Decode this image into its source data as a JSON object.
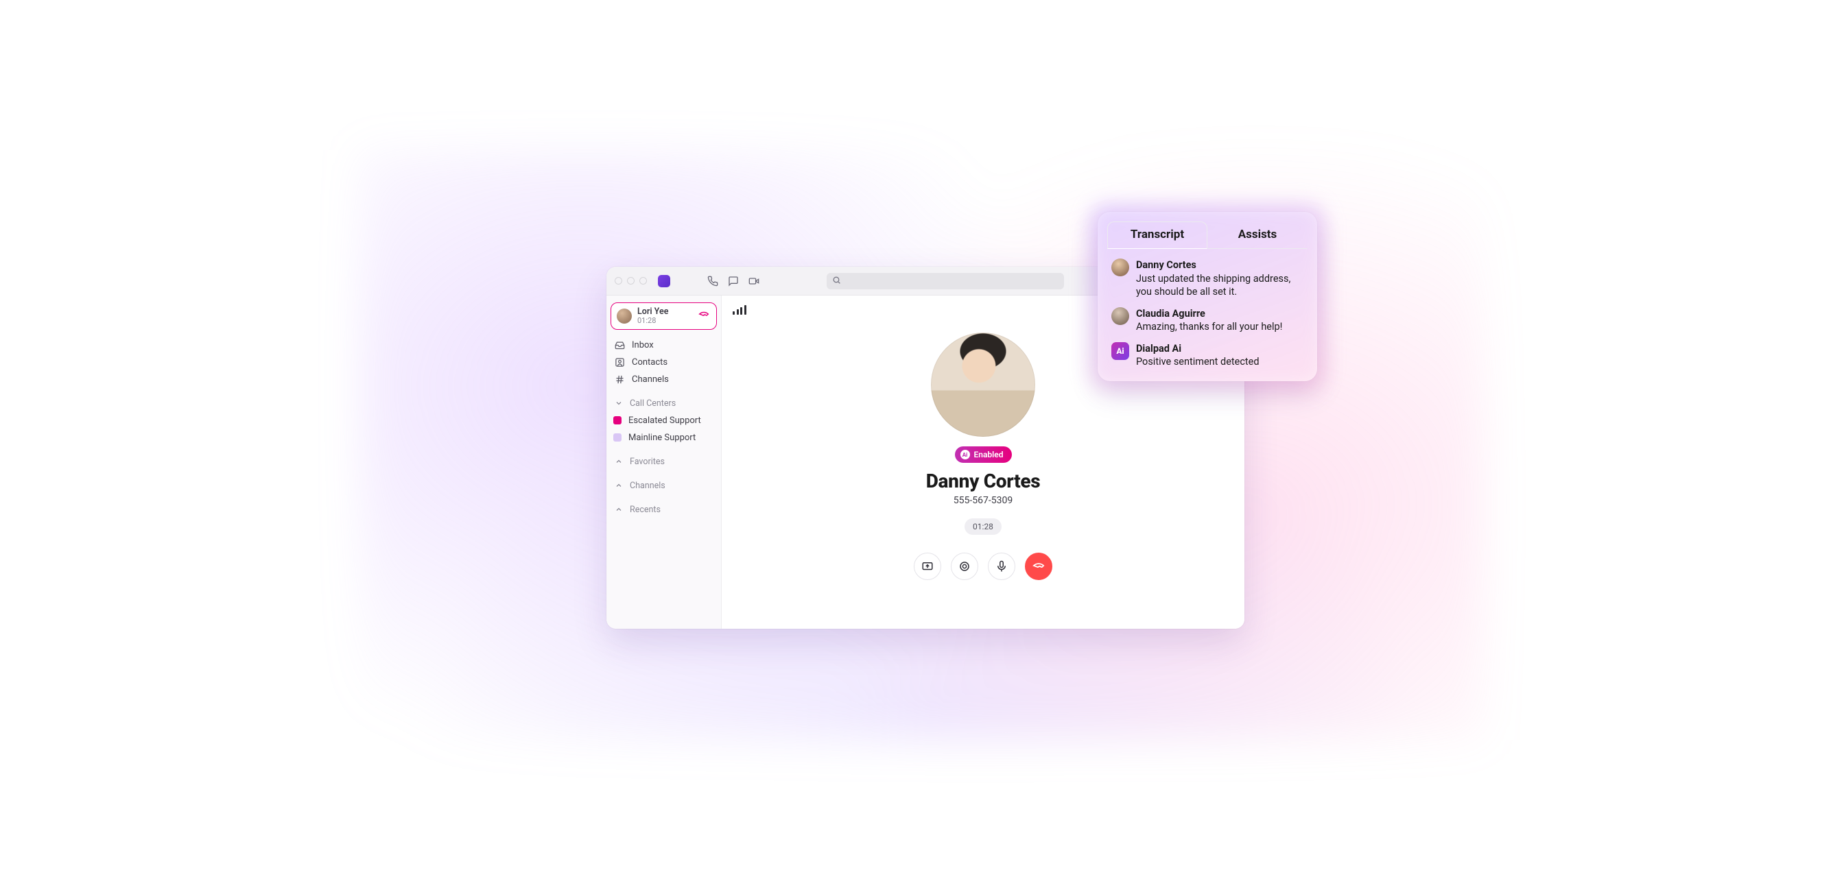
{
  "colors": {
    "brand_pink": "#E6007E",
    "brand_purple": "#7B3FE4",
    "end_red": "#FF4A4A"
  },
  "sidebar": {
    "active_call": {
      "name": "Lori Yee",
      "duration": "01:28"
    },
    "primary": [
      {
        "label": "Inbox"
      },
      {
        "label": "Contacts"
      },
      {
        "label": "Channels"
      }
    ],
    "call_centers_header": "Call Centers",
    "call_centers": [
      {
        "label": "Escalated Support",
        "color": "#E6007E"
      },
      {
        "label": "Mainline Support",
        "color": "#D9C6F5"
      }
    ],
    "collapsed": [
      {
        "label": "Favorites"
      },
      {
        "label": "Channels"
      },
      {
        "label": "Recents"
      }
    ]
  },
  "call": {
    "ai_pill": "Enabled",
    "name": "Danny Cortes",
    "phone": "555-567-5309",
    "duration": "01:28"
  },
  "transcript": {
    "tabs": {
      "transcript": "Transcript",
      "assists": "Assists"
    },
    "messages": [
      {
        "speaker": "Danny Cortes",
        "text": "Just updated the shipping address, you should be all set it.",
        "avatar": "a1"
      },
      {
        "speaker": "Claudia Aguirre",
        "text": "Amazing, thanks for all your help!",
        "avatar": "a2"
      },
      {
        "speaker": "Dialpad Ai",
        "text": "Positive sentiment detected",
        "avatar": "ai"
      }
    ]
  }
}
